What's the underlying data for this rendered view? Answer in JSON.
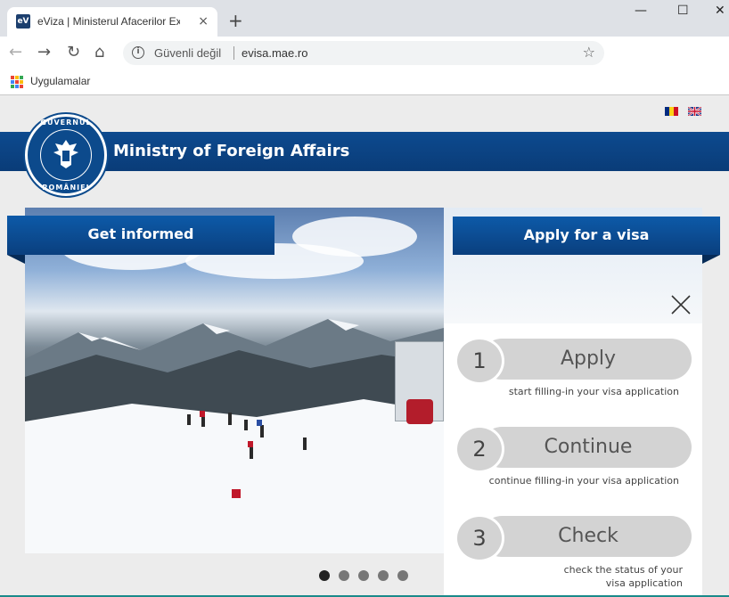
{
  "browser": {
    "tab_title": "eViza | Ministerul Afacerilor Exter",
    "favicon_text": "eV",
    "tab_close": "×",
    "new_tab": "+",
    "window_controls": {
      "minimize": "—",
      "maximize": "☐",
      "close": "✕"
    },
    "nav": {
      "back": "←",
      "forward": "→",
      "reload": "↻",
      "home": "⌂"
    },
    "security_text": "Güvenli değil",
    "url": "evisa.mae.ro",
    "bookmark_star": "☆",
    "apps_label": "Uygulamalar",
    "icons": [
      "info-icon",
      "star-icon",
      "apps-grid-icon"
    ]
  },
  "header": {
    "title": "Ministry of Foreign Affairs",
    "seal_top": "GUVERNUL",
    "seal_bottom": "ROMÂNIEI",
    "languages": [
      "ro-flag-icon",
      "uk-flag-icon"
    ],
    "colors": {
      "brand_blue": "#0c4a8c",
      "ribbon_blue": "#0d5aa8"
    }
  },
  "left": {
    "ribbon_label": "Get informed"
  },
  "right": {
    "ribbon_label": "Apply for a visa",
    "close": "close-icon",
    "steps": [
      {
        "num": "1",
        "label": "Apply",
        "desc": "start filling-in your visa application"
      },
      {
        "num": "2",
        "label": "Continue",
        "desc": "continue filling-in your visa application"
      },
      {
        "num": "3",
        "label": "Check",
        "desc": "check the status of your visa application"
      }
    ]
  },
  "carousel": {
    "slide_count": 5,
    "active_slide": 1
  }
}
